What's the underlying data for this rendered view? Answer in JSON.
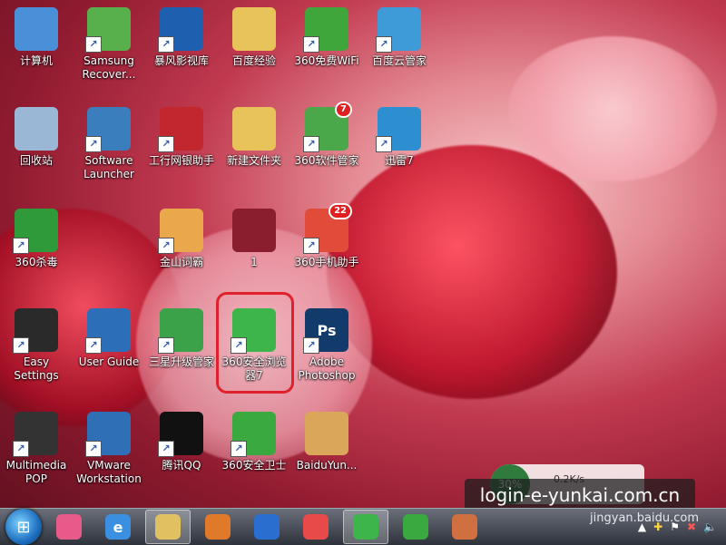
{
  "desktop_icons": [
    {
      "label": "计算机",
      "icon": "computer-icon",
      "color": "#4a90d9",
      "shortcut": false
    },
    {
      "label": "Samsung Recover...",
      "icon": "samsung-recovery-icon",
      "color": "#58b04d",
      "shortcut": true
    },
    {
      "label": "暴风影视库",
      "icon": "storm-video-library-icon",
      "color": "#1f5fb0",
      "shortcut": true
    },
    {
      "label": "百度经验",
      "icon": "folder-icon",
      "color": "#e7c35a",
      "shortcut": false
    },
    {
      "label": "360免费WiFi",
      "icon": "wifi-icon",
      "color": "#3fa63c",
      "shortcut": true
    },
    {
      "label": "百度云管家",
      "icon": "baidu-cloud-icon",
      "color": "#3f9ad8",
      "shortcut": true
    },
    {
      "label": "回收站",
      "icon": "recycle-bin-icon",
      "color": "#9ab8d6",
      "shortcut": false
    },
    {
      "label": "Software Launcher",
      "icon": "software-launcher-icon",
      "color": "#3a7ebd",
      "shortcut": true
    },
    {
      "label": "工行网银助手",
      "icon": "icbc-icon",
      "color": "#c1272d",
      "shortcut": true
    },
    {
      "label": "新建文件夹",
      "icon": "folder-icon",
      "color": "#e7c35a",
      "shortcut": false
    },
    {
      "label": "360软件管家",
      "icon": "software-manager-icon",
      "color": "#4aa84a",
      "shortcut": true,
      "badge": "7"
    },
    {
      "label": "迅雷7",
      "icon": "thunder-bird-icon",
      "color": "#2e8fd0",
      "shortcut": true
    },
    {
      "label": "360杀毒",
      "icon": "antivirus-shield-icon",
      "color": "#2f9a3a",
      "shortcut": true
    },
    {
      "label": "金山词霸",
      "icon": "magnifier-dictionary-icon",
      "color": "#e9a84c",
      "shortcut": true
    },
    {
      "label": "1",
      "icon": "image-thumbnail-icon",
      "color": "#8a1d2e",
      "shortcut": false
    },
    {
      "label": "360手机助手",
      "icon": "phone-assistant-icon",
      "color": "#e14c3a",
      "shortcut": true,
      "badge": "22"
    },
    {
      "label": "Easy Settings",
      "icon": "easy-settings-icon",
      "color": "#2a2a2a",
      "shortcut": true
    },
    {
      "label": "User Guide",
      "icon": "user-guide-icon",
      "color": "#2c6fb8",
      "shortcut": true
    },
    {
      "label": "三星升级管家",
      "icon": "samsung-update-icon",
      "color": "#3ba24a",
      "shortcut": true
    },
    {
      "label": "360安全浏览器7",
      "icon": "browser-360-icon",
      "color": "#3db54a",
      "shortcut": true
    },
    {
      "label": "Adobe Photoshop",
      "icon": "photoshop-icon",
      "color": "#123a6b",
      "shortcut": true,
      "glyph": "Ps"
    },
    {
      "label": "Multimedia POP",
      "icon": "multimedia-pop-icon",
      "color": "#333333",
      "shortcut": true
    },
    {
      "label": "VMware Workstation",
      "icon": "vmware-icon",
      "color": "#2e6fb5",
      "shortcut": true
    },
    {
      "label": "腾讯QQ",
      "icon": "qq-penguin-icon",
      "color": "#111111",
      "shortcut": true
    },
    {
      "label": "360安全卫士",
      "icon": "security-guard-icon",
      "color": "#3aa93f",
      "shortcut": true
    },
    {
      "label": "BaiduYun...",
      "icon": "baidu-yun-package-icon",
      "color": "#d9a65a",
      "shortcut": false
    }
  ],
  "taskbar": {
    "start_icon": "windows-start-icon",
    "pinned": [
      {
        "icon": "app-gallery-icon",
        "color": "#e85a8a"
      },
      {
        "icon": "internet-explorer-icon",
        "color": "#3a8fe0",
        "glyph": "e"
      },
      {
        "icon": "file-explorer-icon",
        "color": "#e0c060",
        "active": true
      },
      {
        "icon": "media-player-icon",
        "color": "#e07a2a"
      },
      {
        "icon": "video-film-icon",
        "color": "#2a6fd0"
      },
      {
        "icon": "colorful-app-icon",
        "color": "#e84a4a"
      },
      {
        "icon": "browser-360-icon",
        "color": "#3db54a",
        "active": true
      },
      {
        "icon": "security-guard-icon",
        "color": "#3aa93f"
      },
      {
        "icon": "paint-icon",
        "color": "#d07040"
      }
    ]
  },
  "speed_widget": {
    "percent": "30%",
    "rate": "0.2K/s"
  },
  "watermark": {
    "text": "login-e-yunkai.com.cn",
    "baidu": "jingyan.baidu.com"
  }
}
